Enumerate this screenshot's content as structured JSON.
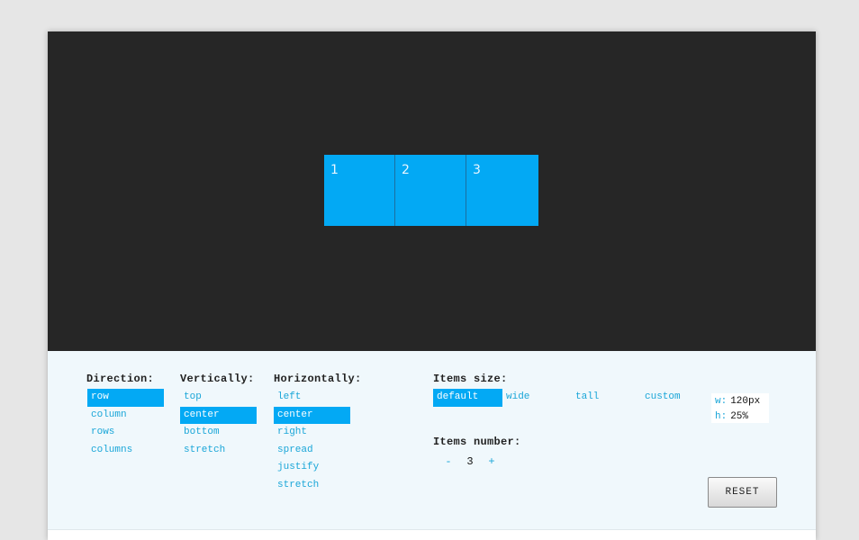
{
  "stage": {
    "items": [
      "1",
      "2",
      "3"
    ],
    "colors": {
      "stage_bg": "#262626",
      "item_bg": "#03a9f4"
    }
  },
  "direction": {
    "title": "Direction:",
    "options": [
      "row",
      "column",
      "rows",
      "columns"
    ],
    "selected": "row"
  },
  "vertically": {
    "title": "Vertically:",
    "options": [
      "top",
      "center",
      "bottom",
      "stretch"
    ],
    "selected": "center"
  },
  "horizontally": {
    "title": "Horizontally:",
    "options": [
      "left",
      "center",
      "right",
      "spread",
      "justify",
      "stretch"
    ],
    "selected": "center"
  },
  "items_size": {
    "title": "Items size:",
    "options": [
      "default",
      "wide",
      "tall",
      "custom"
    ],
    "selected": "default",
    "custom": {
      "w_label": "w:",
      "w_value": "120px",
      "h_label": "h:",
      "h_value": "25%"
    }
  },
  "items_number": {
    "title": "Items number:",
    "minus": "-",
    "value": "3",
    "plus": "+"
  },
  "reset_label": "RESET"
}
